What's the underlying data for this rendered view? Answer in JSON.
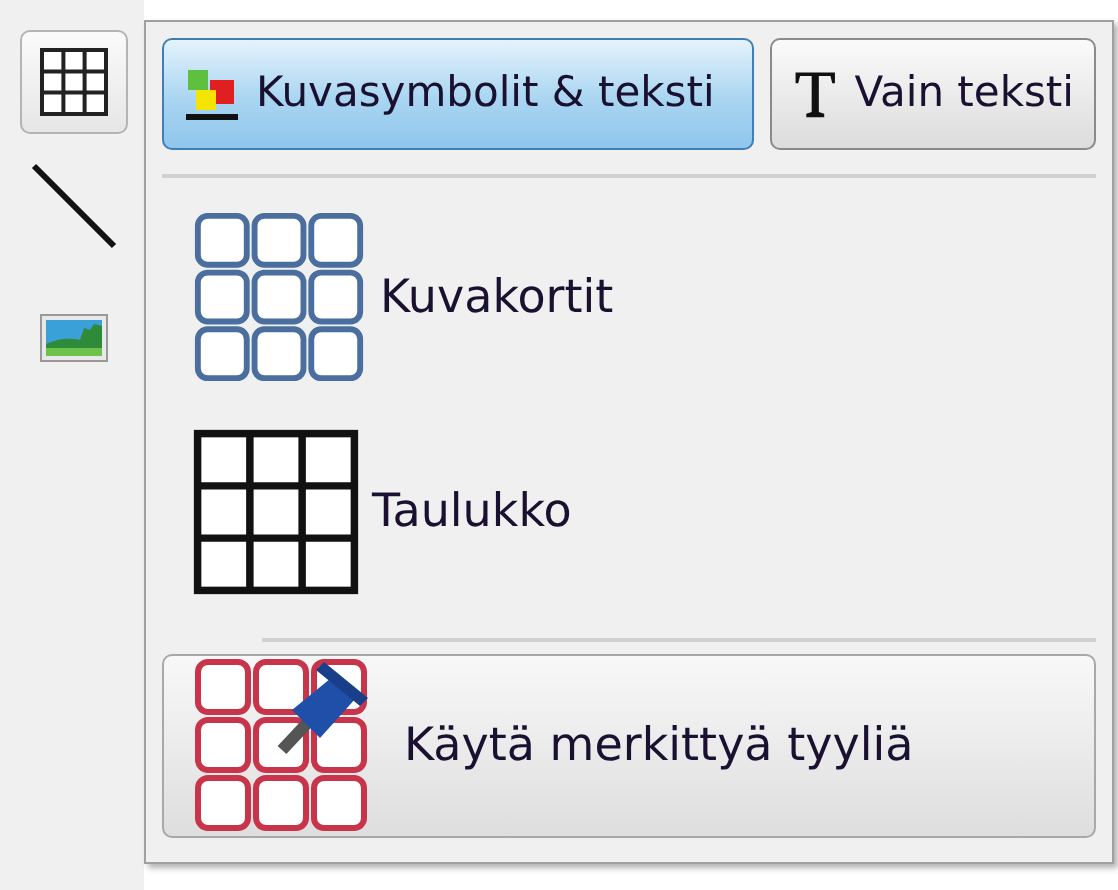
{
  "toolbar": [
    {
      "kind": "table",
      "selected": true
    },
    {
      "kind": "line",
      "selected": false
    },
    {
      "kind": "picture",
      "selected": false
    }
  ],
  "mode_buttons": [
    {
      "kind": "symbols",
      "label": "Kuvasymbolit & teksti",
      "selected": true
    },
    {
      "kind": "text",
      "label": "Vain teksti",
      "selected": false
    }
  ],
  "menu_items": [
    {
      "kind": "cards",
      "label": "Kuvakortit"
    },
    {
      "kind": "table",
      "label": "Taulukko"
    },
    {
      "kind": "styled",
      "label": "Käytä merkittyä tyyliä"
    }
  ]
}
